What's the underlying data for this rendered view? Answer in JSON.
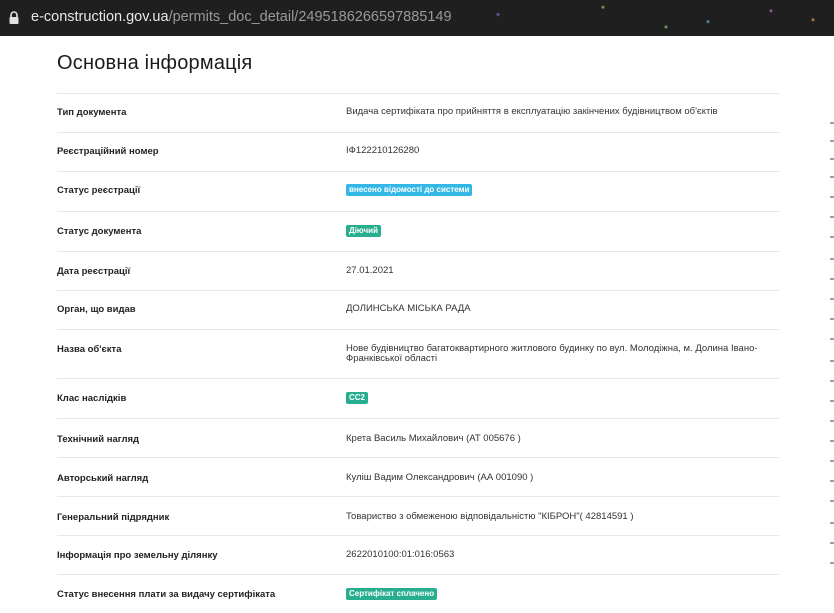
{
  "browser": {
    "url_host": "e-construction.gov.ua",
    "url_path": "/permits_doc_detail/2495186266597885149"
  },
  "page": {
    "title": "Основна інформація"
  },
  "colors": {
    "badge_blue": "#33b7e6",
    "badge_green": "#27ae8f"
  },
  "rows": [
    {
      "label": "Тип документа",
      "value": "Видача сертифіката про прийняття в експлуатацію закінчених будівництвом об'єктів"
    },
    {
      "label": "Реєстраційний номер",
      "value": "ІФ122210126280"
    },
    {
      "label": "Статус реєстрації",
      "badge": "внесено відомості до системи"
    },
    {
      "label": "Статус документа",
      "badge": "Діючий"
    },
    {
      "label": "Дата реєстрації",
      "value": "27.01.2021"
    },
    {
      "label": "Орган, що видав",
      "value": "ДОЛИНСЬКА МІСЬКА РАДА"
    },
    {
      "label": "Назва об'єкта",
      "value": "Нове будівництво багатоквартирного житлового будинку по вул. Молодіжна, м. Долина Івано-Франківської області"
    },
    {
      "label": "Клас наслідків",
      "badge": "СС2"
    },
    {
      "label": "Технічний нагляд",
      "value": "Крета Василь Михайлович (АТ 005676 )"
    },
    {
      "label": "Авторський нагляд",
      "value": "Куліш Вадим Олександрович (АА 001090 )"
    },
    {
      "label": "Генеральний підрядник",
      "value": "Товариство з обмеженою відповідальністю \"КІБРОН\"( 42814591 )"
    },
    {
      "label": "Інформація про земельну ділянку",
      "value": "2622010100:01:016:0563"
    },
    {
      "label": "Статус внесення плати за видачу сертифіката",
      "badge": "Сертифікат сплачено"
    }
  ]
}
